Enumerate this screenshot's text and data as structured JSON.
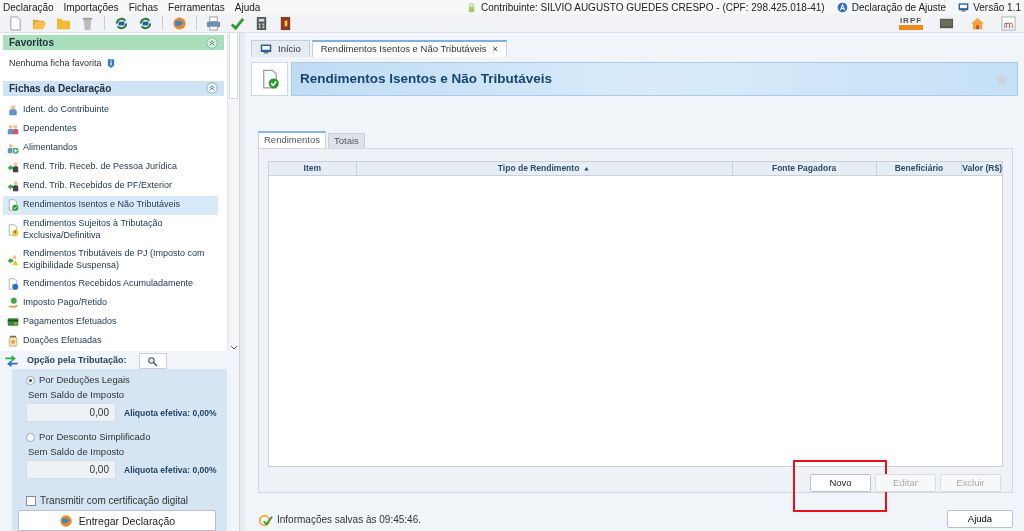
{
  "menu": [
    {
      "label": "Declaração"
    },
    {
      "label": "Importações"
    },
    {
      "label": "Fichas"
    },
    {
      "label": "Ferramentas"
    },
    {
      "label": "Ajuda"
    }
  ],
  "header_info": {
    "contributor": "Contribuinte: SILVIO AUGUSTO GUEDES CRESPO - (CPF: 298.425.018-41)",
    "declaration": "Declaração de Ajuste",
    "version": "Versão 1.1"
  },
  "logo_text": "IRPF",
  "favorites": {
    "title": "Favoritos",
    "expanded": true,
    "empty_text": "Nenhuma ficha favorita"
  },
  "fichas": {
    "title": "Fichas da Declaração",
    "expanded": true,
    "items": [
      {
        "label": "Ident. do Contribuinte",
        "selected": false
      },
      {
        "label": "Dependentes",
        "selected": false
      },
      {
        "label": "Alimentandos",
        "selected": false
      },
      {
        "label": "Rend. Trib. Receb. de Pessoa Jurídica",
        "selected": false
      },
      {
        "label": "Rend. Trib. Recebidos de PF/Exterior",
        "selected": false
      },
      {
        "label": "Rendimentos Isentos e Não Tributáveis",
        "selected": true
      },
      {
        "label": "Rendimentos Sujeitos à Tributação Exclusiva/Definitiva",
        "selected": false
      },
      {
        "label": "Rendimentos Tributáveis de PJ (Imposto com Exigibilidade Suspensa)",
        "selected": false
      },
      {
        "label": "Rendimentos Recebidos Acumuladamente",
        "selected": false
      },
      {
        "label": "Imposto Pago/Retido",
        "selected": false
      },
      {
        "label": "Pagamentos Efetuados",
        "selected": false
      },
      {
        "label": "Doações Efetuadas",
        "selected": false
      }
    ]
  },
  "tax_option": {
    "title": "Opção pela Tributação:",
    "options": [
      {
        "label": "Por Deduções Legais",
        "selected": true,
        "caption": "Sem Saldo de Imposto",
        "value": "0,00",
        "rate": "Aliquota efetiva: 0,00%"
      },
      {
        "label": "Por Desconto Simplificado",
        "selected": false,
        "caption": "Sem Saldo de Imposto",
        "value": "0,00",
        "rate": "Aliquota efetiva: 0,00%"
      }
    ],
    "certificate": {
      "label": "Transmitir com certificação digital",
      "checked": false
    },
    "submit": "Entregar Declaração"
  },
  "doc_tabs": [
    {
      "label": "Início",
      "selected": false
    },
    {
      "label": "Rendimentos Isentos e Não Tributáveis",
      "selected": true,
      "close": "×"
    }
  ],
  "page_title": "Rendimentos Isentos e Não Tributáveis",
  "inner_tabs": [
    {
      "label": "Rendimentos",
      "selected": true
    },
    {
      "label": "Totais",
      "selected": false
    }
  ],
  "table": {
    "columns": [
      {
        "label": "Item",
        "sorted": false
      },
      {
        "label": "Tipo de Rendimento",
        "sorted": true
      },
      {
        "label": "Fonte Pagadora",
        "sorted": false
      },
      {
        "label": "Beneficiário",
        "sorted": false
      },
      {
        "label": "Valor (R$)",
        "sorted": false
      }
    ]
  },
  "actions": [
    {
      "label": "Novo",
      "disabled": false,
      "highlighted": true
    },
    {
      "label": "Editar",
      "disabled": true,
      "highlighted": false
    },
    {
      "label": "Excluir",
      "disabled": true,
      "highlighted": false
    }
  ],
  "status": {
    "text": "Informações salvas às 09:45:46."
  },
  "help_button": "Ajuda"
}
